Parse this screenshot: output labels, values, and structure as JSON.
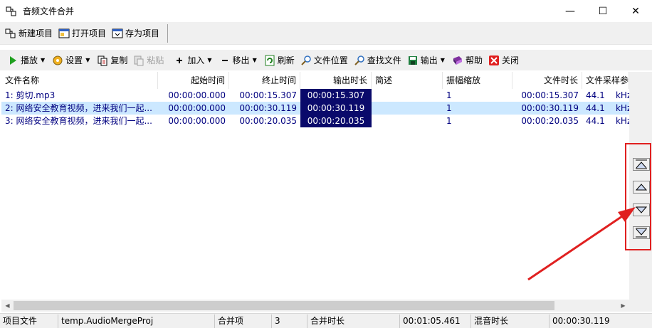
{
  "window": {
    "title": "音频文件合并",
    "minimize": "—",
    "maximize": "☐",
    "close": "✕"
  },
  "toolbar1": {
    "new_project": "新建项目",
    "open_project": "打开项目",
    "save_project": "存为项目"
  },
  "toolbar2": {
    "play": "播放",
    "settings": "设置",
    "copy": "复制",
    "paste": "粘贴",
    "add": "加入",
    "remove": "移出",
    "refresh": "刷新",
    "file_location": "文件位置",
    "find_file": "查找文件",
    "output": "输出",
    "help": "帮助",
    "close": "关闭"
  },
  "table": {
    "headers": [
      "文件名称",
      "起始时间",
      "终止时间",
      "输出时长",
      "简述",
      "振幅缩放",
      "文件时长",
      "文件采样参"
    ],
    "rows": [
      {
        "name": "1: 剪切.mp3",
        "start": "00:00:00.000",
        "end": "00:00:15.307",
        "output": "00:00:15.307",
        "desc": "",
        "amp": "1",
        "duration": "00:00:15.307",
        "sample": "44.1",
        "unit": "kHz"
      },
      {
        "name": "2: 网络安全教育视频，进来我们一起...",
        "start": "00:00:00.000",
        "end": "00:00:30.119",
        "output": "00:00:30.119",
        "desc": "",
        "amp": "1",
        "duration": "00:00:30.119",
        "sample": "44.1",
        "unit": "kHz"
      },
      {
        "name": "3: 网络安全教育视频，进来我们一起...",
        "start": "00:00:00.000",
        "end": "00:00:20.035",
        "output": "00:00:20.035",
        "desc": "",
        "amp": "1",
        "duration": "00:00:20.035",
        "sample": "44.1",
        "unit": "kHz"
      }
    ]
  },
  "statusbar": {
    "project_file_label": "项目文件",
    "project_file_value": "temp.AudioMergeProj",
    "merge_items_label": "合并项",
    "merge_items_value": "3",
    "merge_duration_label": "合并时长",
    "merge_duration_value": "00:01:05.461",
    "mix_duration_label": "混音时长",
    "mix_duration_value": "00:00:30.119"
  },
  "icons": {
    "move_top": "move-top-icon",
    "move_up": "move-up-icon",
    "move_down": "move-down-icon",
    "move_bottom": "move-bottom-icon"
  },
  "colors": {
    "selection": "#cce8ff",
    "output_cell": "#0a0a6b",
    "highlight_box": "#e02020"
  }
}
